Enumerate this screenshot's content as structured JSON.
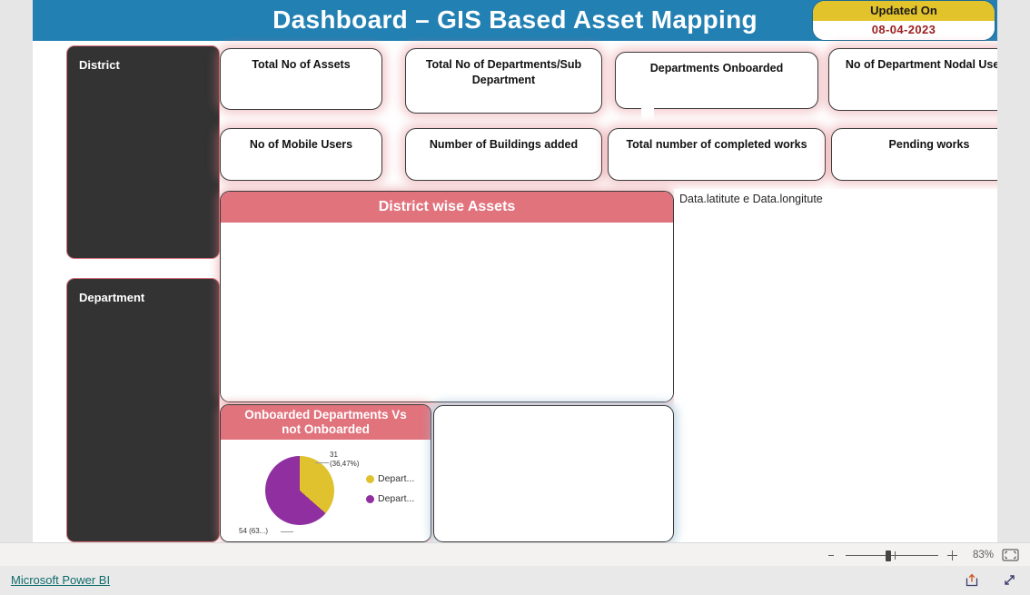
{
  "header": {
    "title": "Dashboard – GIS Based Asset Mapping",
    "updated_label": "Updated On",
    "updated_date": "08-04-2023",
    "bar_color": "#2280b3",
    "badge_top_color": "#e3c32c",
    "badge_date_color": "#9c2020"
  },
  "slicers": [
    {
      "name": "district",
      "title": "District"
    },
    {
      "name": "department",
      "title": "Department"
    }
  ],
  "kpis": [
    {
      "name": "total-no-of-assets",
      "label": "Total No of Assets",
      "value": ""
    },
    {
      "name": "total-no-of-departments",
      "label": "Total No of Departments/Sub Department",
      "value": ""
    },
    {
      "name": "departments-onboarded",
      "label": "Departments Onboarded",
      "value": ""
    },
    {
      "name": "no-of-department-nodal-users",
      "label": "No of Department Nodal Users",
      "value": ""
    },
    {
      "name": "no-of-mobile-users",
      "label": "No of Mobile Users",
      "value": ""
    },
    {
      "name": "number-of-buildings-added",
      "label": "Number of Buildings added",
      "value": ""
    },
    {
      "name": "total-number-of-completed-works",
      "label": "Total number of completed works",
      "value": ""
    },
    {
      "name": "pending-works",
      "label": "Pending works",
      "value": ""
    }
  ],
  "panels": {
    "district_assets_title": "District wise Assets",
    "map_title": "Data.latitute e Data.longitute",
    "pie_title_line1": "Onboarded Departments Vs",
    "pie_title_line2": "not Onboarded",
    "header_color": "#e1737d"
  },
  "chart_data": {
    "type": "pie",
    "title": "Onboarded Departments Vs not Onboarded",
    "categories": [
      "Depart...",
      "Depart..."
    ],
    "values": [
      31,
      54
    ],
    "labels": [
      "31 (36,47%)",
      "54 (63...)"
    ],
    "label_top_line1": "31",
    "label_top_line2": "(36,47%)",
    "label_bottom": "54 (63...)",
    "percentages": [
      36.47,
      63.53
    ],
    "colors": [
      "#e0c22e",
      "#8f2fa0"
    ],
    "legend": [
      {
        "label": "Depart...",
        "color": "#e0c22e"
      },
      {
        "label": "Depart...",
        "color": "#8f2fa0"
      }
    ],
    "legend_position": "right"
  },
  "statusbar": {
    "zoom_value": "83%",
    "minus_label": "−",
    "plus_label": "+",
    "fit_icon": "fit-to-page-icon"
  },
  "footer": {
    "brand": "Microsoft Power BI",
    "share_icon": "share-icon",
    "fullscreen_icon": "fullscreen-icon"
  }
}
